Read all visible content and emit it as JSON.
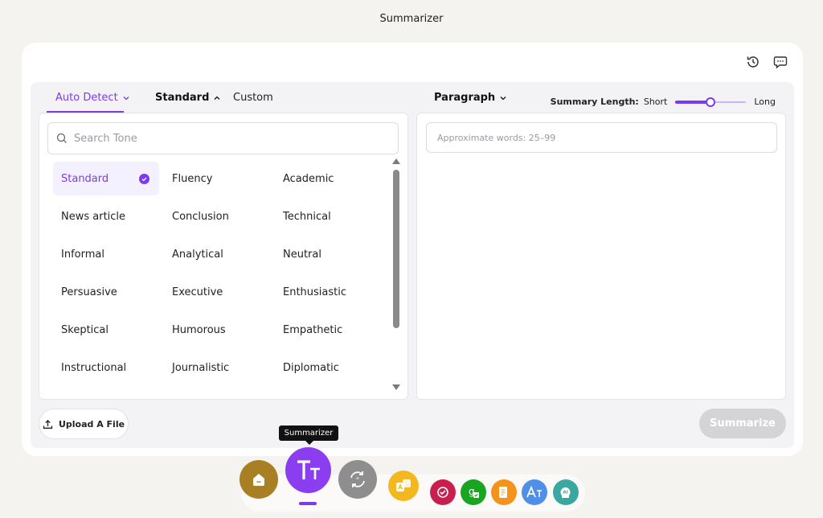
{
  "app_title": "Summarizer",
  "header_icons": [
    "history-icon",
    "feedback-icon"
  ],
  "tabs": {
    "auto_detect": "Auto Detect",
    "standard": "Standard",
    "custom": "Custom",
    "paragraph": "Paragraph"
  },
  "summary_length": {
    "label": "Summary Length:",
    "min_label": "Short",
    "max_label": "Long",
    "value_fraction": 0.5
  },
  "search": {
    "placeholder": "Search Tone",
    "value": ""
  },
  "tones": [
    {
      "label": "Standard",
      "selected": true
    },
    {
      "label": "Fluency"
    },
    {
      "label": "Academic"
    },
    {
      "label": "News article"
    },
    {
      "label": "Conclusion"
    },
    {
      "label": "Technical"
    },
    {
      "label": "Informal"
    },
    {
      "label": "Analytical"
    },
    {
      "label": "Neutral"
    },
    {
      "label": "Persuasive"
    },
    {
      "label": "Executive"
    },
    {
      "label": "Enthusiastic"
    },
    {
      "label": "Skeptical"
    },
    {
      "label": "Humorous"
    },
    {
      "label": "Empathetic"
    },
    {
      "label": "Instructional"
    },
    {
      "label": "Journalistic"
    },
    {
      "label": "Diplomatic"
    }
  ],
  "output": {
    "words_hint": "Approximate words: 25–99"
  },
  "actions": {
    "upload_label": "Upload A File",
    "summarize_label": "Summarize"
  },
  "tooltip": "Summarizer",
  "dock": {
    "colors": {
      "home": "#a97f23",
      "summarizer": "#8b3df0",
      "paraphraser": "#8e8e8e",
      "translator": "#f3b81e",
      "plagiarism": "#c81f4e",
      "grammar": "#1aa521",
      "essay": "#f5921b",
      "ai_writer": "#4f8fe8",
      "ai_detector": "#3aa8a1"
    }
  }
}
